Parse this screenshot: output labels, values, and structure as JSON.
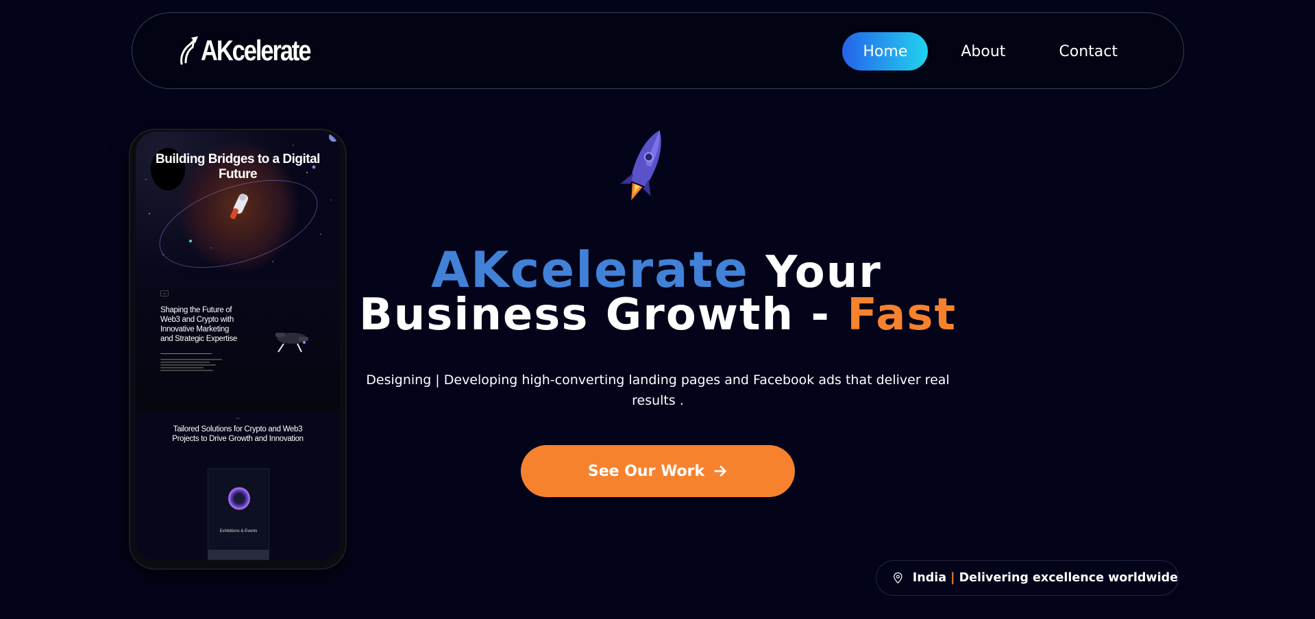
{
  "brand": {
    "logo_text": "AKcelerate"
  },
  "nav": {
    "items": [
      {
        "label": "Home",
        "active": true
      },
      {
        "label": "About",
        "active": false
      },
      {
        "label": "Contact",
        "active": false
      }
    ]
  },
  "phone_preview": {
    "hero_title": "Building Bridges to a Digital Future",
    "section2_title": "Shaping the Future of Web3 and Crypto with Innovative Marketing and Strategic Expertise",
    "section3_title": "Tailored Solutions for Crypto and Web3 Projects to Drive Growth and Innovation",
    "card_title": "Exhibitions & Events"
  },
  "hero": {
    "title_brand": "AKcelerate",
    "title_rest_line1": " Your",
    "title_line2_prefix": "Business Growth - ",
    "title_line2_accent": "Fast",
    "subtitle": "Designing | Developing high-converting landing pages and Facebook ads that deliver real results .",
    "cta_label": "See Our Work"
  },
  "location": {
    "country": "India",
    "separator": "|",
    "tagline": "Delivering excellence worldwide"
  },
  "colors": {
    "background": "#03041a",
    "accent_blue": "#4182d8",
    "accent_orange": "#f7822e",
    "nav_active_start": "#2563eb",
    "nav_active_end": "#22d3ee"
  },
  "icons": [
    "rocket-icon",
    "location-pin-icon",
    "arrow-right-icon"
  ]
}
